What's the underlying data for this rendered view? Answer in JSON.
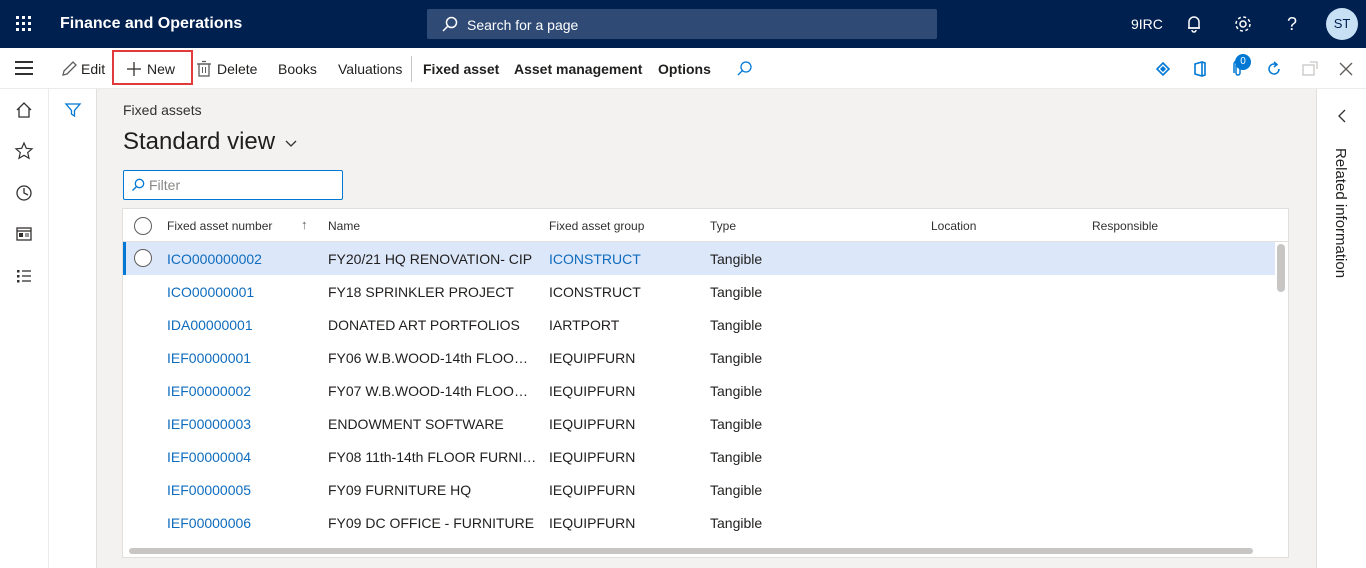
{
  "topbar": {
    "app_title": "Finance and Operations",
    "search_placeholder": "Search for a page",
    "company": "9IRC",
    "user_initials": "ST"
  },
  "actionpane": {
    "edit": "Edit",
    "new": "New",
    "delete": "Delete",
    "books": "Books",
    "valuations": "Valuations",
    "fixed_asset": "Fixed asset",
    "asset_management": "Asset management",
    "options": "Options",
    "attachment_count": "0"
  },
  "page": {
    "breadcrumb": "Fixed assets",
    "view_title": "Standard view",
    "filter_placeholder": "Filter"
  },
  "grid": {
    "columns": [
      "Fixed asset number",
      "Name",
      "Fixed asset group",
      "Type",
      "Location",
      "Responsible"
    ],
    "rows": [
      {
        "number": "ICO000000002",
        "name": "FY20/21 HQ RENOVATION- CIP",
        "group": "ICONSTRUCT",
        "type": "Tangible",
        "location": "",
        "responsible": ""
      },
      {
        "number": "ICO00000001",
        "name": "FY18 SPRINKLER PROJECT",
        "group": "ICONSTRUCT",
        "type": "Tangible",
        "location": "",
        "responsible": ""
      },
      {
        "number": "IDA00000001",
        "name": "DONATED ART PORTFOLIOS",
        "group": "IARTPORT",
        "type": "Tangible",
        "location": "",
        "responsible": ""
      },
      {
        "number": "IEF00000001",
        "name": "FY06 W.B.WOOD-14th FLOOR F...",
        "group": "IEQUIPFURN",
        "type": "Tangible",
        "location": "",
        "responsible": ""
      },
      {
        "number": "IEF00000002",
        "name": "FY07 W.B.WOOD-14th FLOOR F...",
        "group": "IEQUIPFURN",
        "type": "Tangible",
        "location": "",
        "responsible": ""
      },
      {
        "number": "IEF00000003",
        "name": "ENDOWMENT SOFTWARE",
        "group": "IEQUIPFURN",
        "type": "Tangible",
        "location": "",
        "responsible": ""
      },
      {
        "number": "IEF00000004",
        "name": "FY08 11th-14th FLOOR FURNIT...",
        "group": "IEQUIPFURN",
        "type": "Tangible",
        "location": "",
        "responsible": ""
      },
      {
        "number": "IEF00000005",
        "name": "FY09 FURNITURE HQ",
        "group": "IEQUIPFURN",
        "type": "Tangible",
        "location": "",
        "responsible": ""
      },
      {
        "number": "IEF00000006",
        "name": "FY09 DC OFFICE - FURNITURE",
        "group": "IEQUIPFURN",
        "type": "Tangible",
        "location": "",
        "responsible": ""
      }
    ],
    "selected_row": 0
  },
  "right_panel": {
    "label": "Related information"
  },
  "colors": {
    "topbar": "#002050",
    "accent": "#0078d4",
    "link": "#0f6cbd",
    "selected_row": "#dce7fa",
    "highlight": "#e03a3a"
  }
}
